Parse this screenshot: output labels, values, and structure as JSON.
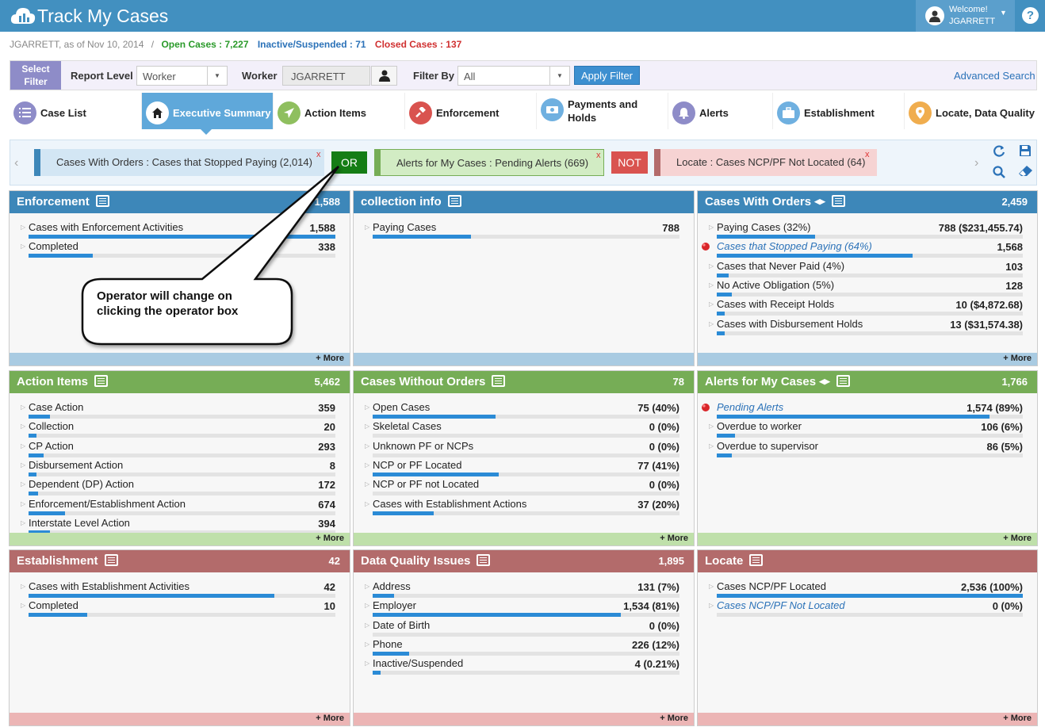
{
  "app": {
    "title": "Track My Cases",
    "welcome": "Welcome!",
    "user": "JGARRETT",
    "help": "?"
  },
  "subheader": {
    "user_date": "JGARRETT, as of Nov 10, 2014",
    "sep": "/",
    "open": "Open Cases : 7,227",
    "inactive": "Inactive/Suspended : 71",
    "closed": "Closed Cases : 137"
  },
  "filter": {
    "select_label": "Select Filter",
    "report_level_label": "Report Level",
    "report_level_value": "Worker",
    "worker_label": "Worker",
    "worker_value": "JGARRETT",
    "filter_by_label": "Filter By",
    "filter_by_value": "All",
    "apply": "Apply Filter",
    "advanced": "Advanced Search"
  },
  "tabs": [
    {
      "label": "Case List",
      "icon": "list-icon"
    },
    {
      "label": "Executive Summary",
      "icon": "home-icon",
      "active": true
    },
    {
      "label": "Action Items",
      "icon": "send-icon"
    },
    {
      "label": "Enforcement",
      "icon": "gavel-icon"
    },
    {
      "label": "Payments and Holds",
      "icon": "money-icon"
    },
    {
      "label": "Alerts",
      "icon": "bell-icon"
    },
    {
      "label": "Establishment",
      "icon": "briefcase-icon"
    },
    {
      "label": "Locate, Data Quality",
      "icon": "map-pin-icon"
    }
  ],
  "criteria": {
    "chips": [
      {
        "text": "Cases With Orders : Cases that Stopped Paying (2,014)",
        "close": "x"
      },
      {
        "text": "Alerts for My Cases : Pending Alerts (669)",
        "close": "x"
      },
      {
        "text": "Locate : Cases NCP/PF Not Located (64)",
        "close": "x"
      }
    ],
    "op1": "OR",
    "op2": "NOT"
  },
  "callout": {
    "line1": "Operator will change on",
    "line2": "clicking the operator box"
  },
  "more_label": "+ More",
  "panels": {
    "enforcement": {
      "title": "Enforcement",
      "total": "1,588",
      "rows": [
        {
          "label": "Cases with Enforcement Activities",
          "value": "1,588",
          "pct": 1.0
        },
        {
          "label": "Completed",
          "value": "338",
          "pct": 0.21
        }
      ]
    },
    "collection": {
      "title": "collection info",
      "total": "",
      "rows": [
        {
          "label": "Paying Cases",
          "value": "788",
          "pct": 0.32
        }
      ]
    },
    "orders": {
      "title": "Cases With Orders",
      "total": "2,459",
      "rows": [
        {
          "label": "Paying Cases (32%)",
          "value": "788 ($231,455.74)",
          "pct": 0.32
        },
        {
          "label": "Cases that Stopped Paying (64%)",
          "value": "1,568",
          "pct": 0.64,
          "link": true,
          "flag": true
        },
        {
          "label": "Cases that Never Paid (4%)",
          "value": "103",
          "pct": 0.04
        },
        {
          "label": "No Active Obligation (5%)",
          "value": "128",
          "pct": 0.05
        },
        {
          "label": "Cases with Receipt Holds",
          "value": "10 ($4,872.68)",
          "pct": 0.01
        },
        {
          "label": "Cases with Disbursement Holds",
          "value": "13 ($31,574.38)",
          "pct": 0.01
        }
      ]
    },
    "action": {
      "title": "Action Items",
      "total": "5,462",
      "rows": [
        {
          "label": "Case Action",
          "value": "359",
          "pct": 0.07
        },
        {
          "label": "Collection",
          "value": "20",
          "pct": 0.01
        },
        {
          "label": "CP Action",
          "value": "293",
          "pct": 0.05
        },
        {
          "label": "Disbursement Action",
          "value": "8",
          "pct": 0.01
        },
        {
          "label": "Dependent (DP) Action",
          "value": "172",
          "pct": 0.03
        },
        {
          "label": "Enforcement/Establishment Action",
          "value": "674",
          "pct": 0.12
        },
        {
          "label": "Interstate Level Action",
          "value": "394",
          "pct": 0.07
        }
      ]
    },
    "without": {
      "title": "Cases Without Orders",
      "total": "78",
      "rows": [
        {
          "label": "Open Cases",
          "value": "75 (40%)",
          "pct": 0.4
        },
        {
          "label": "Skeletal Cases",
          "value": "0 (0%)",
          "pct": 0
        },
        {
          "label": "Unknown PF or NCPs",
          "value": "0 (0%)",
          "pct": 0
        },
        {
          "label": "NCP or PF Located",
          "value": "77 (41%)",
          "pct": 0.41
        },
        {
          "label": "NCP or PF not Located",
          "value": "0 (0%)",
          "pct": 0
        },
        {
          "label": "Cases with Establishment Actions",
          "value": "37 (20%)",
          "pct": 0.2
        }
      ]
    },
    "alerts": {
      "title": "Alerts for My Cases",
      "total": "1,766",
      "rows": [
        {
          "label": "Pending Alerts",
          "value": "1,574 (89%)",
          "pct": 0.89,
          "link": true,
          "flag": true
        },
        {
          "label": "Overdue to worker",
          "value": "106 (6%)",
          "pct": 0.06
        },
        {
          "label": "Overdue to supervisor",
          "value": "86 (5%)",
          "pct": 0.05
        }
      ]
    },
    "establishment": {
      "title": "Establishment",
      "total": "42",
      "rows": [
        {
          "label": "Cases with Establishment Activities",
          "value": "42",
          "pct": 0.8
        },
        {
          "label": "Completed",
          "value": "10",
          "pct": 0.19
        }
      ]
    },
    "dq": {
      "title": "Data Quality Issues",
      "total": "1,895",
      "rows": [
        {
          "label": "Address",
          "value": "131 (7%)",
          "pct": 0.07
        },
        {
          "label": "Employer",
          "value": "1,534 (81%)",
          "pct": 0.81
        },
        {
          "label": "Date of Birth",
          "value": "0 (0%)",
          "pct": 0
        },
        {
          "label": "Phone",
          "value": "226 (12%)",
          "pct": 0.12
        },
        {
          "label": "Inactive/Suspended",
          "value": "4 (0.21%)",
          "pct": 0.0021
        }
      ]
    },
    "locate": {
      "title": "Locate",
      "total": "",
      "rows": [
        {
          "label": "Cases NCP/PF Located",
          "value": "2,536 (100%)",
          "pct": 1.0
        },
        {
          "label": "Cases NCP/PF Not Located",
          "value": "0 (0%)",
          "pct": 0,
          "link": true
        }
      ]
    }
  },
  "colors": {
    "blue_header": "#3d87b9",
    "green_header": "#76ad56",
    "red_header": "#b36b6b",
    "blue_foot": "#a9cbe2",
    "green_foot": "#bfe0aa",
    "red_foot": "#ecb5b5",
    "bar": "#2b8bd6"
  }
}
